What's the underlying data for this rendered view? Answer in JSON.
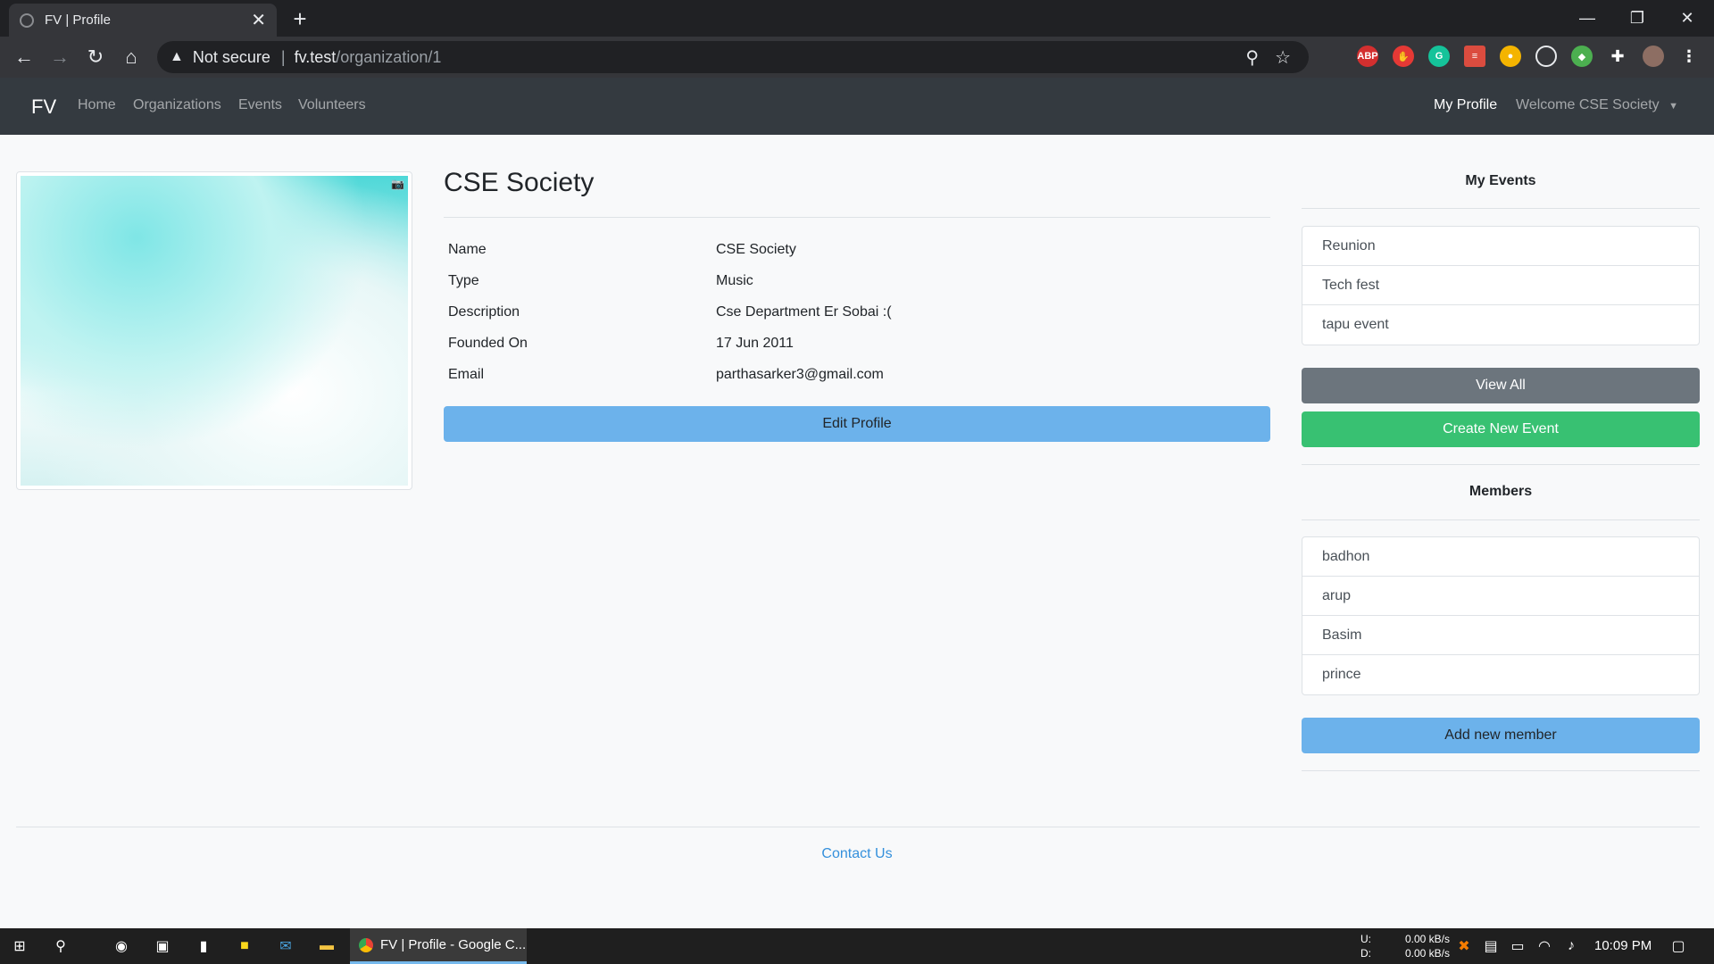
{
  "browser": {
    "tab_title": "FV | Profile",
    "tab_close": "✕",
    "new_tab": "+",
    "not_secure": "Not secure",
    "url_host": "fv.test",
    "url_path": "/organization/1"
  },
  "nav": {
    "brand": "FV",
    "links": [
      "Home",
      "Organizations",
      "Events",
      "Volunteers"
    ],
    "my_profile": "My Profile",
    "welcome": "Welcome CSE Society"
  },
  "profile": {
    "heading": "CSE Society",
    "rows": [
      {
        "label": "Name",
        "value": "CSE Society"
      },
      {
        "label": "Type",
        "value": "Music"
      },
      {
        "label": "Description",
        "value": "Cse Department Er Sobai :("
      },
      {
        "label": "Founded On",
        "value": "17 Jun 2011"
      },
      {
        "label": "Email",
        "value": "parthasarker3@gmail.com"
      }
    ],
    "edit_button": "Edit Profile"
  },
  "sidebar": {
    "events_title": "My Events",
    "events": [
      "Reunion",
      "Tech fest",
      "tapu event"
    ],
    "view_all": "View All",
    "create_event": "Create New Event",
    "members_title": "Members",
    "members": [
      "badhon",
      "arup",
      "Basim",
      "prince"
    ],
    "add_member": "Add new member"
  },
  "footer": {
    "contact": "Contact Us"
  },
  "taskbar": {
    "app_label": "FV | Profile - Google C...",
    "net_labels": [
      "U:",
      "D:"
    ],
    "net_values": [
      "0.00 kB/s",
      "0.00 kB/s"
    ],
    "time": "10:09 PM"
  },
  "colors": {
    "info": "#6cb2eb",
    "secondary": "#6c757d",
    "success": "#38c172",
    "link": "#3490dc",
    "navbar": "#343a40"
  }
}
